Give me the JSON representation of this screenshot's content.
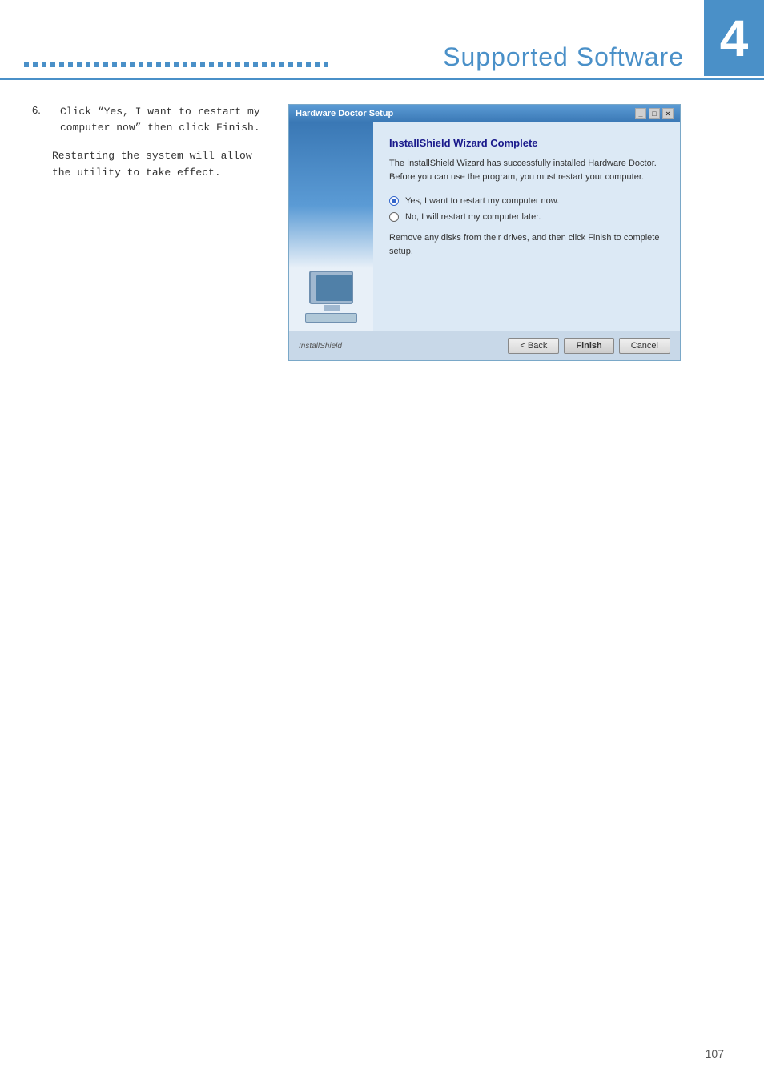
{
  "header": {
    "title": "Supported Software",
    "chapter_number": "4",
    "dots_count": 35
  },
  "content": {
    "step": {
      "number": "6.",
      "instruction": "Click “Yes, I want to restart my computer now” then click Finish.",
      "description": "Restarting the system will allow the utility to take effect."
    }
  },
  "dialog": {
    "title": "Hardware Doctor Setup",
    "wizard": {
      "heading": "InstallShield Wizard Complete",
      "description": "The InstallShield Wizard has successfully installed Hardware Doctor. Before you can use the program, you must restart your computer.",
      "radio_yes": "Yes, I want to restart my computer now.",
      "radio_no": "No, I will restart my computer later.",
      "footer_note": "Remove any disks from their drives, and then click Finish to complete setup."
    },
    "footer": {
      "brand": "InstallShield",
      "back_label": "< Back",
      "finish_label": "Finish",
      "cancel_label": "Cancel"
    }
  },
  "page_number": "107"
}
